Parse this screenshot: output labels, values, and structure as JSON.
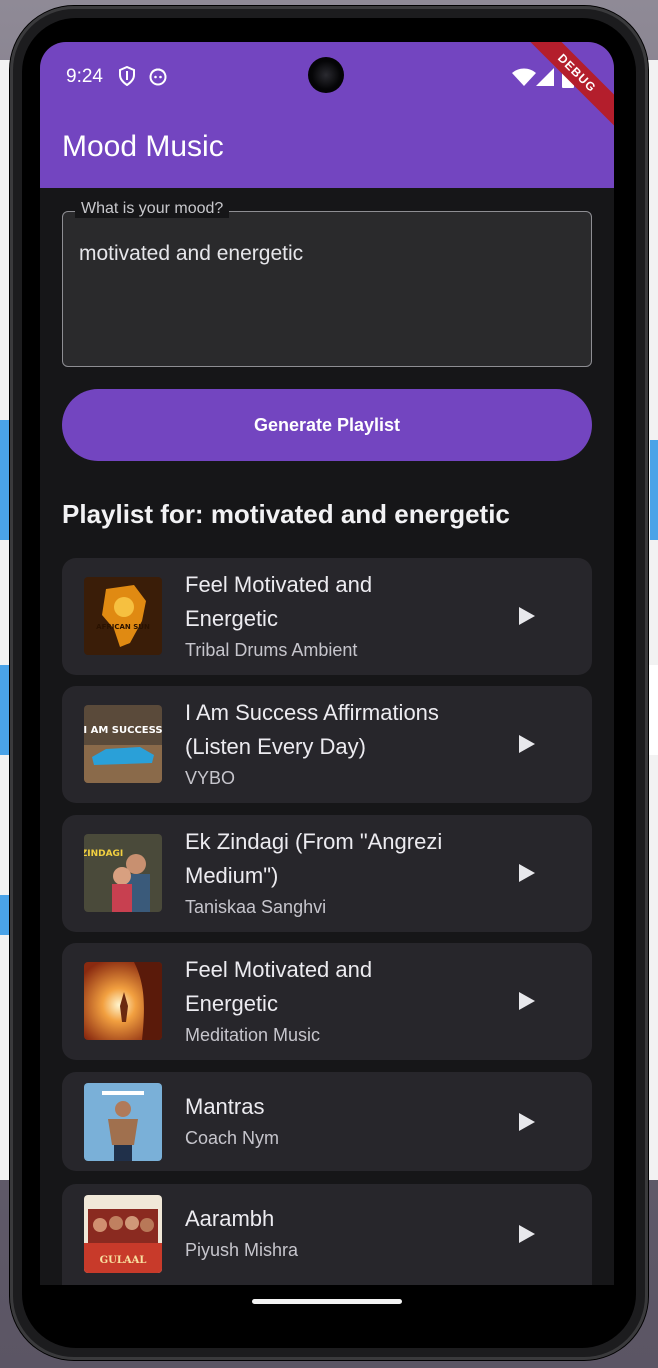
{
  "status_bar": {
    "time": "9:24"
  },
  "app_bar": {
    "title": "Mood Music",
    "debug_label": "DEBUG",
    "color": "#7345c0"
  },
  "mood_input": {
    "label": "What is your mood?",
    "value": "motivated and energetic"
  },
  "generate_button": {
    "label": "Generate Playlist"
  },
  "playlist": {
    "heading": "Playlist for: motivated and energetic",
    "songs": [
      {
        "title_line1": "Feel Motivated and",
        "title_line2": "Energetic",
        "artist": "Tribal Drums Ambient",
        "art_text": "AFRICAN SUN"
      },
      {
        "title_line1": "I Am Success Affirmations",
        "title_line2": "(Listen Every Day)",
        "artist": "VYBO",
        "art_text": "I AM SUCCESS"
      },
      {
        "title_line1": "Ek Zindagi (From \"Angrezi",
        "title_line2": "Medium\")",
        "artist": "Taniskaa Sanghvi",
        "art_text": "ZINDAGI"
      },
      {
        "title_line1": "Feel Motivated and",
        "title_line2": "Energetic",
        "artist": "Meditation Music"
      },
      {
        "title_line1": "Mantras",
        "title_line2": "",
        "artist": "Coach Nym"
      },
      {
        "title_line1": "Aarambh",
        "title_line2": "",
        "artist": "Piyush Mishra",
        "art_text": "GULAAL"
      }
    ]
  },
  "icons": {
    "play": "play-icon",
    "shield": "shield-icon",
    "face": "face-icon",
    "wifi": "wifi-icon",
    "signal": "signal-icon",
    "battery": "battery-icon"
  }
}
